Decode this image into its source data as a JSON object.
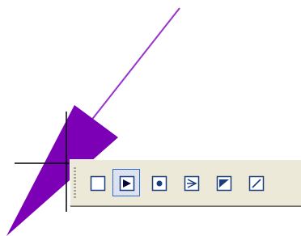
{
  "canvas": {
    "background": "#ffffff",
    "line_color": "#9932cc",
    "shape_fill": "#7b00b6",
    "crosshair_color": "#000000"
  },
  "toolbar": {
    "active_index": 1,
    "buttons": [
      {
        "name": "square-shape-button",
        "icon": "square-outline-icon",
        "active": false
      },
      {
        "name": "play-arrow-button",
        "icon": "play-arrow-icon",
        "active": true
      },
      {
        "name": "circle-dot-button",
        "icon": "dot-in-box-icon",
        "active": false
      },
      {
        "name": "arrow-right-button",
        "icon": "right-arrow-icon",
        "active": false
      },
      {
        "name": "filled-triangle-button",
        "icon": "filled-triangle-icon",
        "active": false
      },
      {
        "name": "diagonal-line-button",
        "icon": "diagonal-line-icon",
        "active": false
      }
    ]
  }
}
